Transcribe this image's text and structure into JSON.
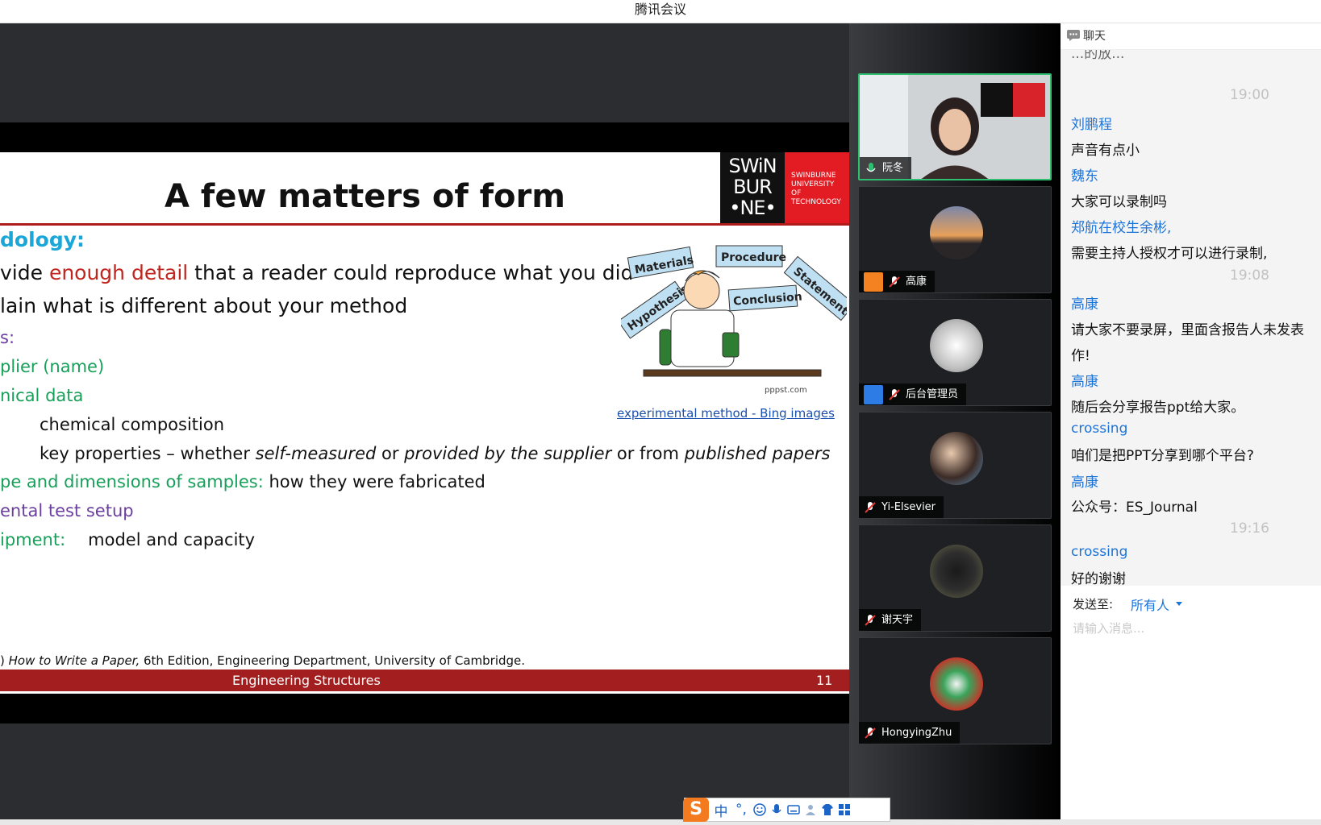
{
  "window": {
    "title": "腾讯会议"
  },
  "slide": {
    "title": "A few matters of form",
    "logo": {
      "lines": [
        "SWiN",
        "BUR",
        "•NE•"
      ],
      "red_lines": [
        "SWINBURNE",
        "UNIVERSITY OF",
        "TECHNOLOGY"
      ]
    },
    "heading": "dology:",
    "line1_pre": "vide ",
    "line1_highlight": "enough detail",
    "line1_post": " that a reader could reproduce what you did",
    "line2": "lain what is different about your method",
    "sub_s": "s:",
    "supplier": "plier (name)",
    "technical": "nical data",
    "chem": "chemical composition",
    "keyprops_a": "key properties – whether ",
    "keyprops_b": "self-measured",
    "keyprops_c": " or ",
    "keyprops_d": "provided by the supplier",
    "keyprops_e": " or from ",
    "keyprops_f": "published papers",
    "shape_label": "pe and dimensions of samples:",
    "shape_value": " how they were fabricated",
    "test_setup": "ental test setup",
    "equip_label": "ipment:",
    "equip_value": "model and capacity",
    "clipart_labels": [
      "Materials",
      "Procedure",
      "Hypothesis",
      "Conclusion",
      "Statement"
    ],
    "clipart_credit": "pppst.com",
    "link": "experimental method - Bing images",
    "footnote_pre": ") ",
    "footnote_it": "How to Write a Paper,",
    "footnote_post": " 6th Edition, Engineering Department, University of Cambridge.",
    "footer_text": "Engineering Structures",
    "footer_num": "11"
  },
  "participants": [
    {
      "name": "阮冬",
      "mic": "on",
      "active": true
    },
    {
      "name": "高康",
      "mic": "muted",
      "active": false
    },
    {
      "name": "后台管理员",
      "mic": "muted",
      "active": false
    },
    {
      "name": "Yi-Elsevier",
      "mic": "muted",
      "active": false
    },
    {
      "name": "谢天宇",
      "mic": "muted",
      "active": false
    },
    {
      "name": "HongyingZhu",
      "mic": "muted",
      "active": false
    }
  ],
  "chat": {
    "header": "聊天",
    "cut_top": "...的放...",
    "t1": "19:00",
    "m1_sender": "刘鹏程",
    "m1_text": "声音有点小",
    "m2_sender": "魏东",
    "m2_text": "大家可以录制吗",
    "m3_sender": "郑航在校生余彬,",
    "m3_text": "需要主持人授权才可以进行录制,",
    "t2": "19:08",
    "m4_sender": "高康",
    "m4_text1": "请大家不要录屏，里面含报告人未发表",
    "m4_text2": "作!",
    "m5_sender": "高康",
    "m5_text": "随后会分享报告ppt给大家。",
    "m6_sender": "crossing",
    "m6_text": "咱们是把PPT分享到哪个平台?",
    "m7_sender": "高康",
    "m7_text": "公众号：ES_Journal",
    "t3": "19:16",
    "m8_sender": "crossing",
    "m8_text": "好的谢谢",
    "send_to_label": "发送至:",
    "send_to_target": "所有人",
    "input_placeholder": "请输入消息..."
  },
  "ime": {
    "lang": "中",
    "punct": "°,"
  },
  "colors": {
    "accent_blue": "#1c74d8",
    "slide_red": "#a31f1f",
    "active_green": "#2fbf71"
  }
}
